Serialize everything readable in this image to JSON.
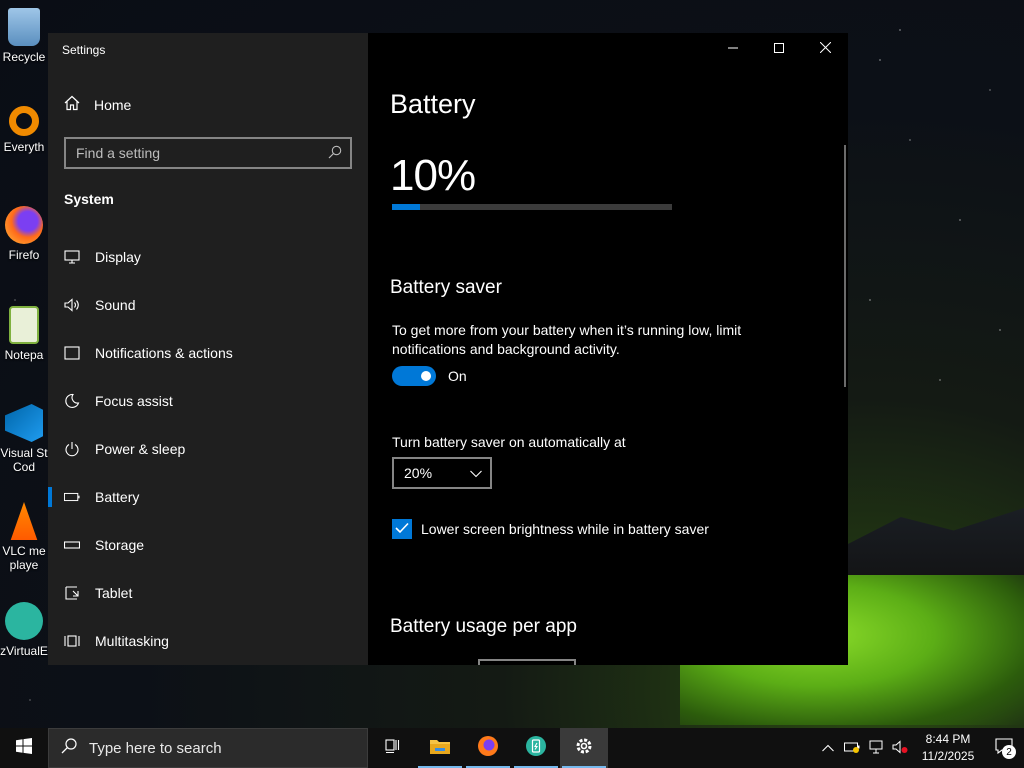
{
  "desktop": {
    "icons": [
      {
        "label": "Recycle",
        "icon": "recycle-bin-icon"
      },
      {
        "label": "Everyth",
        "icon": "everything-search-icon"
      },
      {
        "label": "Firefo",
        "icon": "firefox-icon"
      },
      {
        "label": "Notepa",
        "icon": "notepad-plus-plus-icon"
      },
      {
        "label": "Visual St",
        "label2": "Cod",
        "icon": "vscode-icon"
      },
      {
        "label": "VLC me",
        "label2": "playe",
        "icon": "vlc-icon"
      },
      {
        "label": "zVirtualE",
        "icon": "zvirtual-icon"
      }
    ]
  },
  "window": {
    "app_title": "Settings",
    "home_label": "Home",
    "search_placeholder": "Find a setting",
    "section_title": "System",
    "nav": [
      {
        "label": "Display",
        "icon": "display-icon"
      },
      {
        "label": "Sound",
        "icon": "sound-icon"
      },
      {
        "label": "Notifications & actions",
        "icon": "notifications-icon"
      },
      {
        "label": "Focus assist",
        "icon": "moon-icon"
      },
      {
        "label": "Power & sleep",
        "icon": "power-icon"
      },
      {
        "label": "Battery",
        "icon": "battery-icon",
        "active": true
      },
      {
        "label": "Storage",
        "icon": "storage-icon"
      },
      {
        "label": "Tablet",
        "icon": "tablet-icon"
      },
      {
        "label": "Multitasking",
        "icon": "multitasking-icon"
      }
    ]
  },
  "content": {
    "page_title": "Battery",
    "battery_percent_text": "10%",
    "battery_level": 0.1,
    "saver_heading": "Battery saver",
    "saver_description": "To get more from your battery when it’s running low, limit notifications and background activity.",
    "saver_toggle_label": "On",
    "auto_on_label": "Turn battery saver on automatically at",
    "auto_on_value": "20%",
    "lower_brightness_label": "Lower screen brightness while in battery saver",
    "usage_heading": "Battery usage per app"
  },
  "taskbar": {
    "search_placeholder": "Type here to search",
    "apps": [
      "task-view-icon",
      "file-explorer-icon",
      "firefox-icon",
      "zvirtual-icon",
      "settings-icon"
    ],
    "time": "8:44 PM",
    "date": "11/2/2025",
    "notification_count": "2"
  },
  "colors": {
    "accent": "#0078d7",
    "sidebar_bg": "#1f1f1f",
    "content_bg": "#000000"
  }
}
